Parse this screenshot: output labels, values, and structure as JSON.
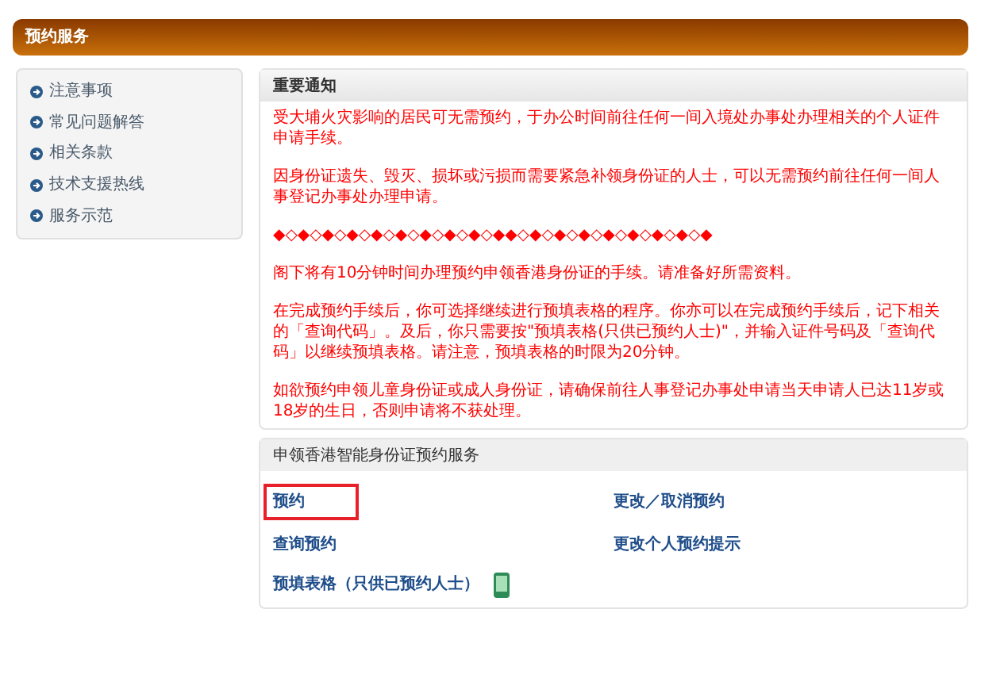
{
  "header": {
    "title": "预约服务"
  },
  "sidebar": {
    "items": [
      {
        "label": "注意事项"
      },
      {
        "label": "常见问题解答"
      },
      {
        "label": "相关条款"
      },
      {
        "label": "技术支援热线"
      },
      {
        "label": "服务示范"
      }
    ]
  },
  "notice": {
    "title": "重要通知",
    "paragraphs": [
      "受大埔火灾影响的居民可无需预约，于办公时间前往任何一间入境处办事处办理相关的个人证件申请手续。",
      "因身份证遗失、毁灭、损坏或污损而需要紧急补领身份证的人士，可以无需预约前往任何一间人事登记办事处办理申请。",
      "◆◇◆◇◆◇◆◇◆◇◆◇◆◇◆◇◆◇◆◆◇◆◇◆◇◆◇◆◇◆◇◆◇◆◇◆",
      "阁下将有10分钟时间办理预约申领香港身份证的手续。请准备好所需资料。",
      "在完成预约手续后，你可选择继续进行预填表格的程序。你亦可以在完成预约手续后，记下相关的「查询代码」。及后，你只需要按\"预填表格(只供已预约人士)\"，并输入证件号码及「查询代码」以继续预填表格。请注意，预填表格的时限为20分钟。",
      "如欲预约申领儿童身份证或成人身份证，请确保前往人事登记办事处申请当天申请人已达11岁或18岁的生日，否则申请将不获处理。"
    ]
  },
  "services": {
    "title": "申领香港智能身份证预约服务",
    "links": [
      {
        "label": "预约",
        "highlighted": true
      },
      {
        "label": "更改／取消预约",
        "highlighted": false
      },
      {
        "label": "查询预约",
        "highlighted": false
      },
      {
        "label": "更改个人预约提示",
        "highlighted": false
      },
      {
        "label": "预填表格（只供已预约人士）",
        "highlighted": false,
        "icon": true
      }
    ]
  }
}
